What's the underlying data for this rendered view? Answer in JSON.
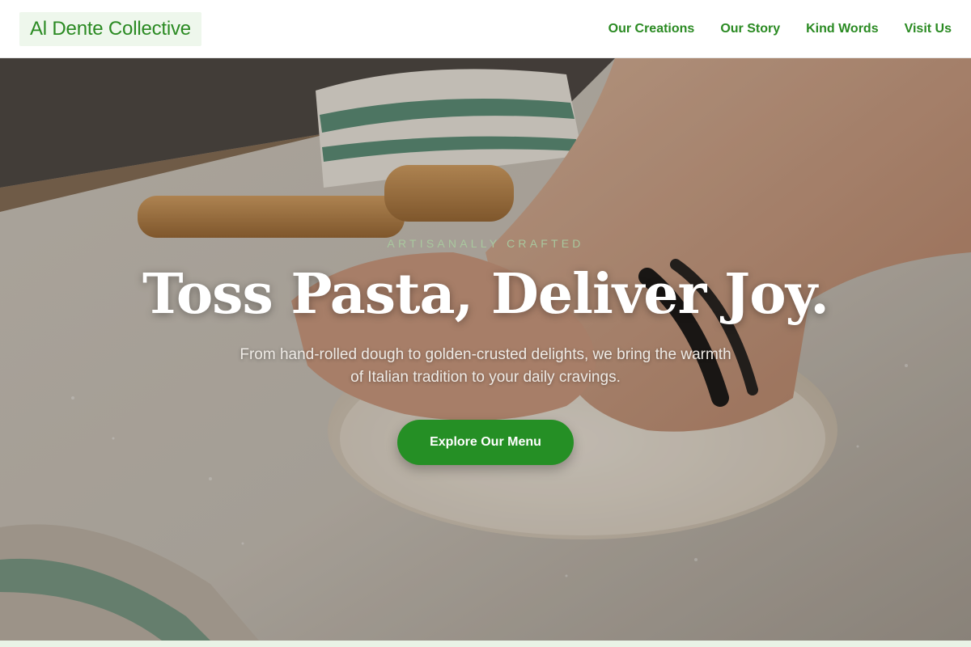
{
  "header": {
    "brand": "Al Dente Collective",
    "nav": [
      {
        "label": "Our Creations"
      },
      {
        "label": "Our Story"
      },
      {
        "label": "Kind Words"
      },
      {
        "label": "Visit Us"
      }
    ]
  },
  "hero": {
    "eyebrow": "ARTISANALLY CRAFTED",
    "headline": "Toss Pasta, Deliver Joy.",
    "subtitle": "From hand-rolled dough to golden-crusted delights, we bring the warmth of Italian tradition to your daily cravings.",
    "cta_label": "Explore Our Menu",
    "image_icon": "kneading-dough-photo"
  },
  "colors": {
    "brand_green": "#2a8a22",
    "cta_green": "#258f25",
    "eyebrow_green": "#a9c79e"
  }
}
